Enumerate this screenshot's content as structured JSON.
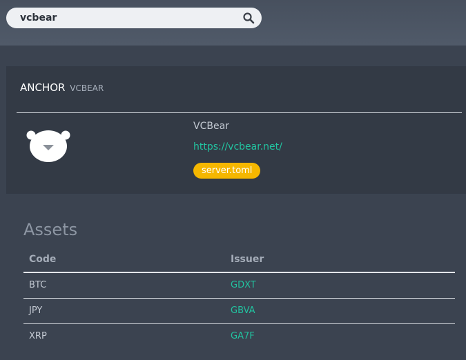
{
  "search": {
    "value": "vcbear"
  },
  "anchor": {
    "label": "ANCHOR",
    "code": "VCBEAR",
    "name": "VCBear",
    "url": "https://vcbear.net/",
    "toml_badge": "server.toml"
  },
  "assets": {
    "heading": "Assets",
    "columns": {
      "code": "Code",
      "issuer": "Issuer"
    },
    "rows": [
      {
        "code": "BTC",
        "issuer": "GDXT"
      },
      {
        "code": "JPY",
        "issuer": "GBVA"
      },
      {
        "code": "XRP",
        "issuer": "GA7F"
      }
    ]
  },
  "colors": {
    "accent_green": "#22c3a0",
    "badge_yellow": "#f5b700",
    "card_bg": "#333a45",
    "page_bg": "#3b4350"
  },
  "icons": {
    "search": "search-icon",
    "logo": "bear-logo-icon"
  }
}
